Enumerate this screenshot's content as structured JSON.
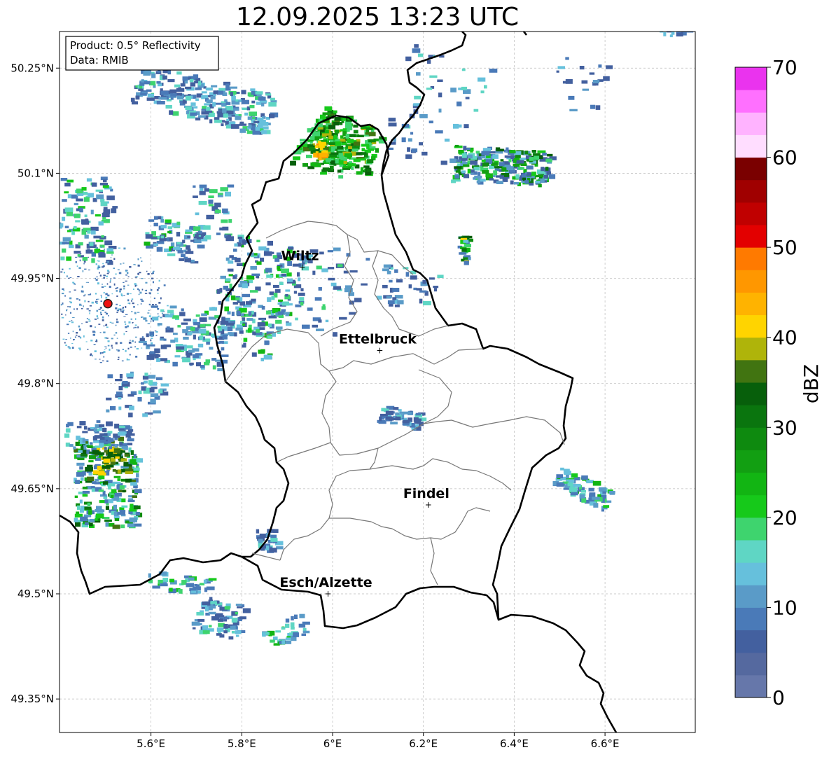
{
  "title": "12.09.2025 13:23 UTC",
  "info_box": {
    "product": "Product: 0.5° Reflectivity",
    "data": "Data: RMIB"
  },
  "map": {
    "lon_range": [
      5.4,
      6.8
    ],
    "lat_range": [
      49.3,
      50.3
    ],
    "lon_ticks": [
      {
        "value": 5.6,
        "label": "5.6°E"
      },
      {
        "value": 5.8,
        "label": "5.8°E"
      },
      {
        "value": 6.0,
        "label": "6°E"
      },
      {
        "value": 6.2,
        "label": "6.2°E"
      },
      {
        "value": 6.4,
        "label": "6.4°E"
      },
      {
        "value": 6.6,
        "label": "6.6°E"
      }
    ],
    "lat_ticks": [
      {
        "value": 50.25,
        "label": "50.25°N"
      },
      {
        "value": 50.1,
        "label": "50.1°N"
      },
      {
        "value": 49.95,
        "label": "49.95°N"
      },
      {
        "value": 49.8,
        "label": "49.8°N"
      },
      {
        "value": 49.65,
        "label": "49.65°N"
      },
      {
        "value": 49.5,
        "label": "49.5°N"
      },
      {
        "value": 49.35,
        "label": "49.35°N"
      }
    ],
    "grid": true,
    "radar_site": {
      "lon": 5.505,
      "lat": 49.914
    },
    "cities": [
      {
        "name": "Wiltz",
        "lon": 5.933,
        "lat": 49.966
      },
      {
        "name": "Ettelbruck",
        "lon": 6.104,
        "lat": 49.847
      },
      {
        "name": "Findel",
        "lon": 6.211,
        "lat": 49.627
      },
      {
        "name": "Esch/Alzette",
        "lon": 5.99,
        "lat": 49.5
      }
    ]
  },
  "colorbar": {
    "label": "dBZ",
    "min": 0,
    "max": 70,
    "step": 2.5,
    "ticks": [
      "0",
      "10",
      "20",
      "30",
      "40",
      "50",
      "60",
      "70"
    ],
    "colors": [
      "#6677aa",
      "#55699f",
      "#43609f",
      "#4a7ab8",
      "#5a9bc8",
      "#66c0dc",
      "#5fd6c4",
      "#3ed46e",
      "#16c91a",
      "#12b513",
      "#129f12",
      "#0e8a0f",
      "#0a750e",
      "#075f0b",
      "#417411",
      "#afb40a",
      "#ffd400",
      "#ffb300",
      "#ff9700",
      "#ff7a00",
      "#e30000",
      "#c00000",
      "#a00000",
      "#7a0000",
      "#ffddff",
      "#ffb3ff",
      "#ff70ff",
      "#ea33ee"
    ]
  }
}
